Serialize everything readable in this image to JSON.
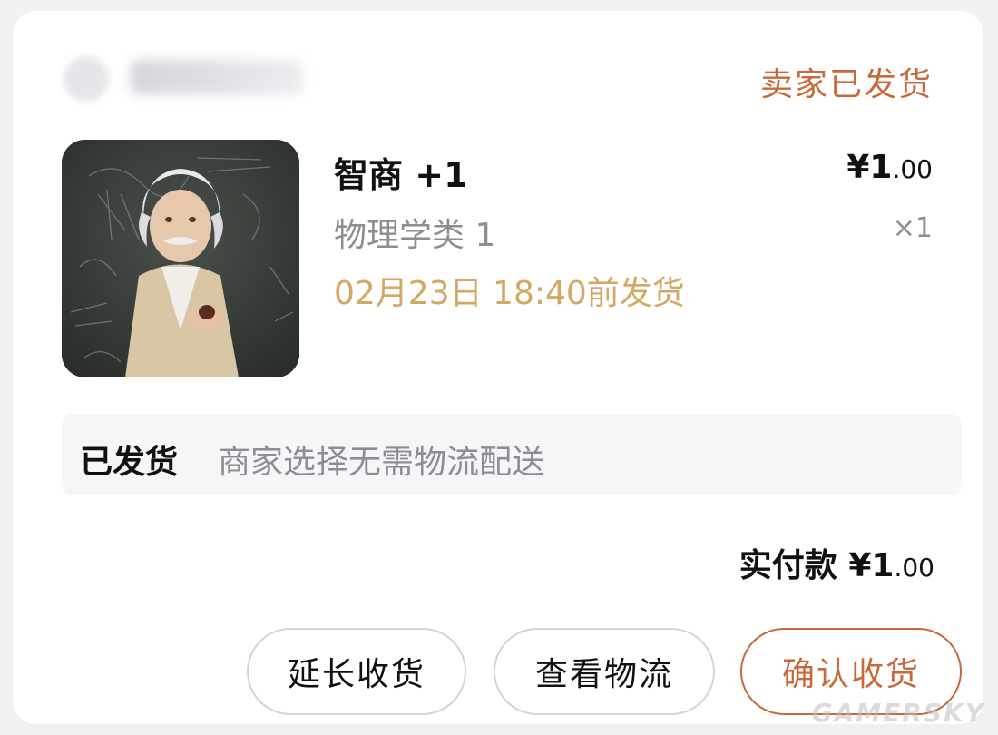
{
  "order": {
    "status": "卖家已发货",
    "item": {
      "title": "智商 +1",
      "spec": "物理学类 1",
      "ship_deadline": "02月23日 18:40前发货",
      "price_symbol": "¥",
      "price_int": "1",
      "price_dec": ".00",
      "quantity": "×1"
    },
    "logistics": {
      "status": "已发货",
      "description": "商家选择无需物流配送"
    },
    "paid": {
      "label": "实付款",
      "symbol": "¥",
      "amount_int": "1",
      "amount_dec": ".00"
    },
    "actions": {
      "extend": "延长收货",
      "track": "查看物流",
      "confirm": "确认收货"
    }
  },
  "watermark": "GAMERSKY",
  "colors": {
    "accent": "#c9683a",
    "deadline": "#d2a864",
    "muted": "#8d8d92"
  }
}
